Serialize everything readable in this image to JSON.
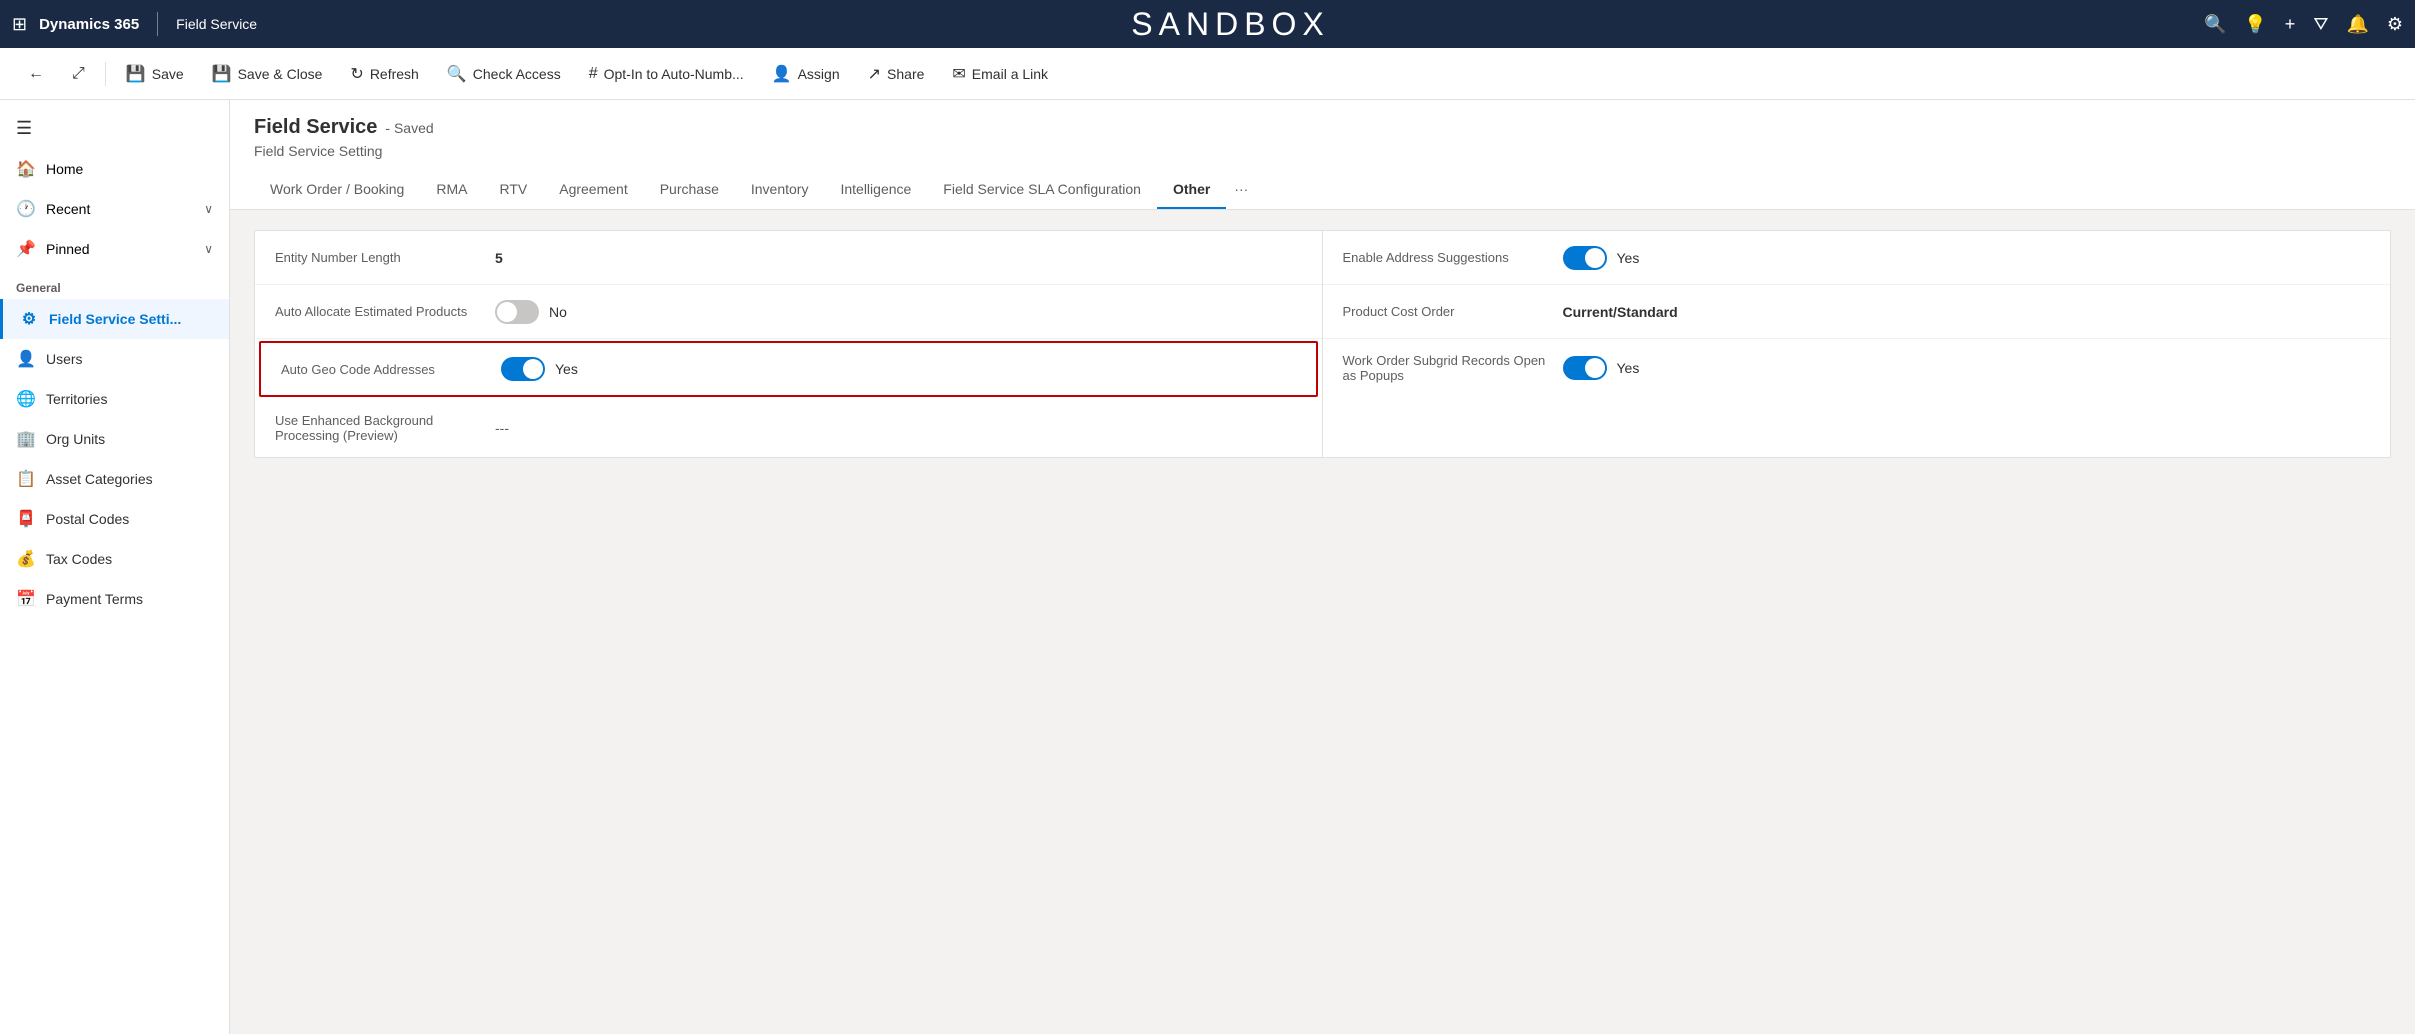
{
  "topNav": {
    "gridIcon": "⊞",
    "brandName": "Dynamics 365",
    "appName": "Field Service",
    "centerTitle": "SANDBOX",
    "icons": [
      "🔍",
      "💡",
      "+",
      "▽",
      "🔔",
      "⚙"
    ]
  },
  "commandBar": {
    "backLabel": "←",
    "openLabel": "⤢",
    "saveLabel": "Save",
    "saveCloseLabel": "Save & Close",
    "refreshLabel": "Refresh",
    "checkAccessLabel": "Check Access",
    "optInLabel": "Opt-In to Auto-Numb...",
    "assignLabel": "Assign",
    "shareLabel": "Share",
    "emailLinkLabel": "Email a Link"
  },
  "sidebar": {
    "hamburgerIcon": "☰",
    "items": [
      {
        "id": "home",
        "icon": "🏠",
        "label": "Home"
      },
      {
        "id": "recent",
        "icon": "🕐",
        "label": "Recent",
        "expand": "∨"
      },
      {
        "id": "pinned",
        "icon": "📌",
        "label": "Pinned",
        "expand": "∨"
      }
    ],
    "sectionLabel": "General",
    "navItems": [
      {
        "id": "field-service-settings",
        "icon": "⚙",
        "label": "Field Service Setti...",
        "active": true
      },
      {
        "id": "users",
        "icon": "👤",
        "label": "Users"
      },
      {
        "id": "territories",
        "icon": "🌐",
        "label": "Territories"
      },
      {
        "id": "org-units",
        "icon": "🏢",
        "label": "Org Units"
      },
      {
        "id": "asset-categories",
        "icon": "📋",
        "label": "Asset Categories"
      },
      {
        "id": "postal-codes",
        "icon": "📮",
        "label": "Postal Codes"
      },
      {
        "id": "tax-codes",
        "icon": "💰",
        "label": "Tax Codes"
      },
      {
        "id": "payment-terms",
        "icon": "📅",
        "label": "Payment Terms"
      }
    ]
  },
  "pageHeader": {
    "title": "Field Service",
    "savedLabel": "- Saved",
    "subtitle": "Field Service Setting"
  },
  "tabs": [
    {
      "id": "work-order-booking",
      "label": "Work Order / Booking",
      "active": false
    },
    {
      "id": "rma",
      "label": "RMA",
      "active": false
    },
    {
      "id": "rtv",
      "label": "RTV",
      "active": false
    },
    {
      "id": "agreement",
      "label": "Agreement",
      "active": false
    },
    {
      "id": "purchase",
      "label": "Purchase",
      "active": false
    },
    {
      "id": "inventory",
      "label": "Inventory",
      "active": false
    },
    {
      "id": "intelligence",
      "label": "Intelligence",
      "active": false
    },
    {
      "id": "field-service-sla",
      "label": "Field Service SLA Configuration",
      "active": false
    },
    {
      "id": "other",
      "label": "Other",
      "active": true
    }
  ],
  "formLeft": {
    "rows": [
      {
        "id": "entity-number-length",
        "label": "Entity Number Length",
        "valueType": "text",
        "value": "5",
        "bold": true
      },
      {
        "id": "auto-allocate",
        "label": "Auto Allocate Estimated Products",
        "valueType": "toggle",
        "toggleOn": false,
        "toggleText": "No"
      },
      {
        "id": "auto-geo-code",
        "label": "Auto Geo Code Addresses",
        "valueType": "toggle",
        "toggleOn": true,
        "toggleText": "Yes",
        "highlighted": true
      },
      {
        "id": "use-enhanced",
        "label": "Use Enhanced Background Processing (Preview)",
        "valueType": "dash",
        "value": "---"
      }
    ]
  },
  "formRight": {
    "rows": [
      {
        "id": "enable-address-suggestions",
        "label": "Enable Address Suggestions",
        "valueType": "toggle",
        "toggleOn": true,
        "toggleText": "Yes"
      },
      {
        "id": "product-cost-order",
        "label": "Product Cost Order",
        "valueType": "text",
        "value": "Current/Standard",
        "bold": true
      },
      {
        "id": "work-order-subgrid",
        "label": "Work Order Subgrid Records Open as Popups",
        "valueType": "toggle",
        "toggleOn": true,
        "toggleText": "Yes"
      }
    ]
  }
}
